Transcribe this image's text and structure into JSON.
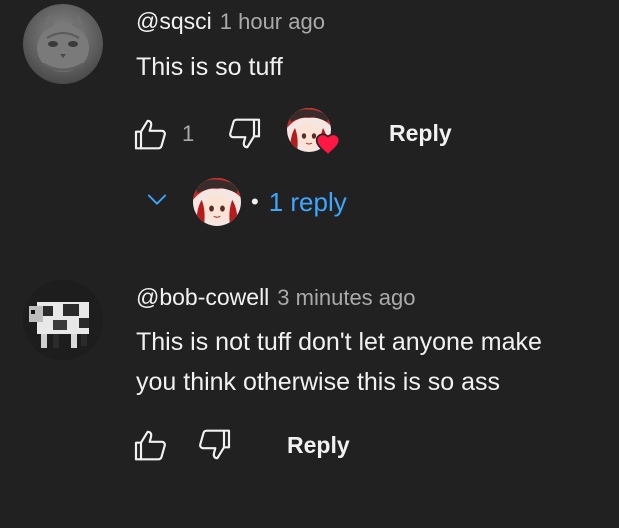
{
  "comments": [
    {
      "author": "@sqsci",
      "time": "1 hour ago",
      "text": "This is so tuff",
      "like_count": "1",
      "reply_label": "Reply",
      "replies_label": "1 reply"
    },
    {
      "author": "@bob-cowell",
      "time": "3 minutes ago",
      "text_line1": "This is not tuff don't let anyone make",
      "text_line2": "you think otherwise this is so ass",
      "reply_label": "Reply"
    }
  ],
  "colors": {
    "background": "#212121",
    "text": "#f1f1f1",
    "secondary": "#aaaaaa",
    "link": "#3ea6ff",
    "heart": "#ff1744"
  },
  "icons": [
    "thumb-up-icon",
    "thumb-down-icon",
    "heart-icon",
    "chevron-down-icon"
  ]
}
